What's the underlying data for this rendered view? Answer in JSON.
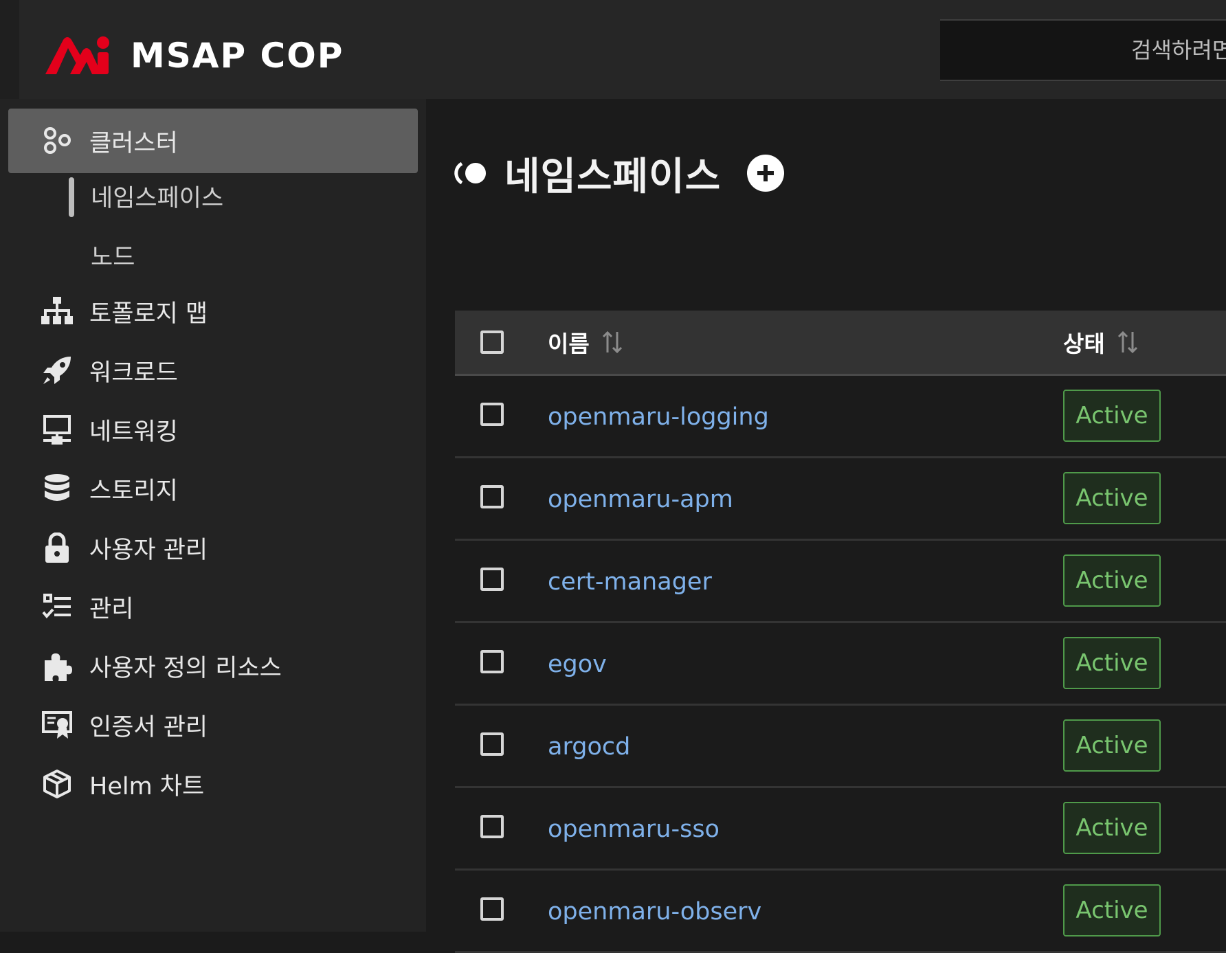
{
  "header": {
    "logo_text": "MSAP COP",
    "search_placeholder": "검색하려면"
  },
  "sidebar": {
    "items": [
      {
        "label": "클러스터",
        "icon": "cluster-icon"
      },
      {
        "label": "토폴로지 맵",
        "icon": "sitemap-icon"
      },
      {
        "label": "워크로드",
        "icon": "rocket-icon"
      },
      {
        "label": "네트워킹",
        "icon": "network-icon"
      },
      {
        "label": "스토리지",
        "icon": "database-icon"
      },
      {
        "label": "사용자 관리",
        "icon": "lock-icon"
      },
      {
        "label": "관리",
        "icon": "checklist-icon"
      },
      {
        "label": "사용자 정의 리소스",
        "icon": "puzzle-icon"
      },
      {
        "label": "인증서 관리",
        "icon": "certificate-icon"
      },
      {
        "label": "Helm 차트",
        "icon": "package-icon"
      }
    ],
    "sub_items": [
      {
        "label": "네임스페이스"
      },
      {
        "label": "노드"
      }
    ]
  },
  "main": {
    "title": "네임스페이스",
    "table": {
      "columns": {
        "name": "이름",
        "status": "상태"
      },
      "rows": [
        {
          "name": "openmaru-logging",
          "status": "Active"
        },
        {
          "name": "openmaru-apm",
          "status": "Active"
        },
        {
          "name": "cert-manager",
          "status": "Active"
        },
        {
          "name": "egov",
          "status": "Active"
        },
        {
          "name": "argocd",
          "status": "Active"
        },
        {
          "name": "openmaru-sso",
          "status": "Active"
        },
        {
          "name": "openmaru-observ",
          "status": "Active"
        }
      ]
    }
  },
  "colors": {
    "accent_logo": "#e3001b",
    "link": "#7fb1ea",
    "status_active_text": "#79c56f",
    "status_active_border": "#4f9a4a"
  }
}
